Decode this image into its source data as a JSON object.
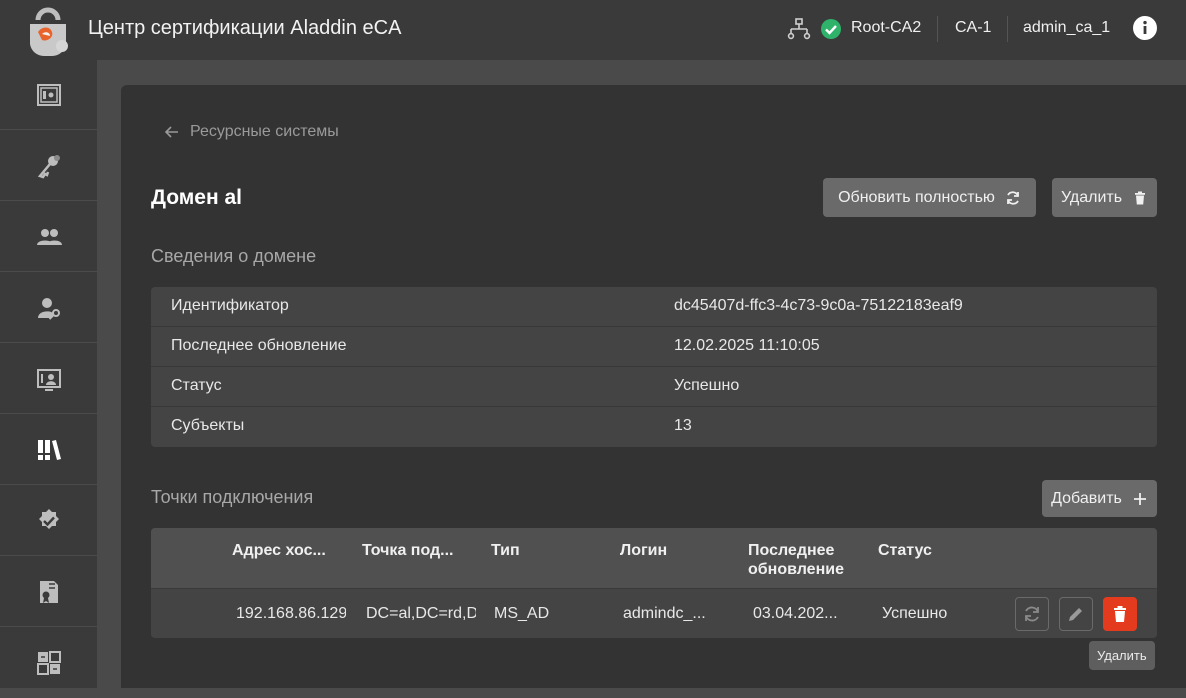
{
  "header": {
    "app_title": "Центр сертификации Aladdin eCA",
    "root_ca": "Root-CA2",
    "ca": "CA-1",
    "user": "admin_ca_1"
  },
  "sidebar": {
    "items": [
      {
        "icon": "safe-icon"
      },
      {
        "icon": "keys-icon"
      },
      {
        "icon": "users-icon"
      },
      {
        "icon": "user-key-icon"
      },
      {
        "icon": "user-card-icon"
      },
      {
        "icon": "library-icon"
      },
      {
        "icon": "badge-check-icon"
      },
      {
        "icon": "certificate-icon"
      },
      {
        "icon": "grid-icon"
      }
    ]
  },
  "breadcrumb": "Ресурсные системы",
  "page_title": "Домен al",
  "buttons": {
    "refresh_full": "Обновить полностью",
    "delete": "Удалить",
    "add": "Добавить"
  },
  "domain_info": {
    "title": "Сведения о домене",
    "rows": [
      {
        "key": "Идентификатор",
        "value": "dc45407d-ffc3-4c73-9c0a-75122183eaf9"
      },
      {
        "key": "Последнее обновление",
        "value": "12.02.2025 11:10:05"
      },
      {
        "key": "Статус",
        "value": "Успешно"
      },
      {
        "key": "Субъекты",
        "value": "13"
      }
    ]
  },
  "connections": {
    "title": "Точки подключения",
    "columns": [
      "Адрес хос...",
      "Точка под...",
      "Тип",
      "Логин",
      "Последнее обновление",
      "Статус"
    ],
    "rows": [
      {
        "address": "192.168.86.129",
        "point": "DC=al,DC=rd,DC",
        "type": "MS_AD",
        "login": "admindc_...",
        "updated": "03.04.202...",
        "status": "Успешно"
      }
    ]
  },
  "tooltip": "Удалить",
  "colors": {
    "success": "#2fb36b",
    "danger": "#e43b1e",
    "accent_logo": "#e8642c"
  }
}
